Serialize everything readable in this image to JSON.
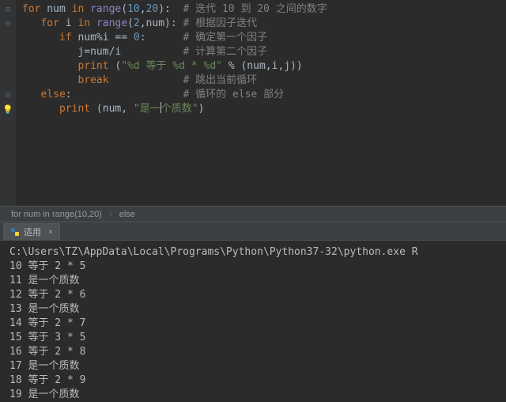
{
  "code": {
    "lines": [
      {
        "indent": 0,
        "type": "for",
        "tokens": [
          "for",
          "num",
          "in",
          "range",
          "(",
          "10",
          ",",
          "20",
          "):"
        ],
        "comment": "# 迭代 10 到 20 之间的数字"
      },
      {
        "indent": 1,
        "type": "for",
        "tokens": [
          "for",
          "i",
          "in",
          "range",
          "(",
          "2",
          ",",
          "num",
          "):"
        ],
        "comment": "# 根据因子迭代"
      },
      {
        "indent": 2,
        "type": "if",
        "tokens": [
          "if",
          "num",
          "%",
          "i",
          "==",
          "0",
          ":"
        ],
        "comment": "# 确定第一个因子"
      },
      {
        "indent": 3,
        "type": "assign",
        "tokens": [
          "j",
          "=",
          "num",
          "/",
          "i"
        ],
        "comment": "# 计算第二个因子"
      },
      {
        "indent": 3,
        "type": "print",
        "tokens": [
          "print",
          "(",
          "\"%d 等于 %d * %d\"",
          "%",
          "(",
          "num",
          ",",
          "i",
          ",",
          "j",
          ")",
          ")"
        ],
        "comment": ""
      },
      {
        "indent": 3,
        "type": "break",
        "tokens": [
          "break"
        ],
        "comment": "# 跳出当前循环"
      },
      {
        "indent": 1,
        "type": "else",
        "tokens": [
          "else",
          ":"
        ],
        "comment": "# 循环的 else 部分"
      },
      {
        "indent": 2,
        "type": "print2",
        "tokens": [
          "print",
          "(",
          "num",
          ",",
          " ",
          "\"是一",
          "|",
          "个质数\"",
          ")"
        ],
        "comment": ""
      }
    ]
  },
  "breadcrumb": {
    "item1": "for num in range(10,20)",
    "item2": "else"
  },
  "tab": {
    "label": "适用",
    "close": "×"
  },
  "terminal": {
    "cmd": "C:\\Users\\TZ\\AppData\\Local\\Programs\\Python\\Python37-32\\python.exe R",
    "out": [
      "10 等于 2 * 5",
      "11 是一个质数",
      "12 等于 2 * 6",
      "13 是一个质数",
      "14 等于 2 * 7",
      "15 等于 3 * 5",
      "16 等于 2 * 8",
      "17 是一个质数",
      "18 等于 2 * 9",
      "19 是一个质数"
    ]
  },
  "gutter_icons": [
    "⊟",
    "⊟",
    "",
    "",
    "",
    "",
    "⊟",
    "⊡"
  ]
}
